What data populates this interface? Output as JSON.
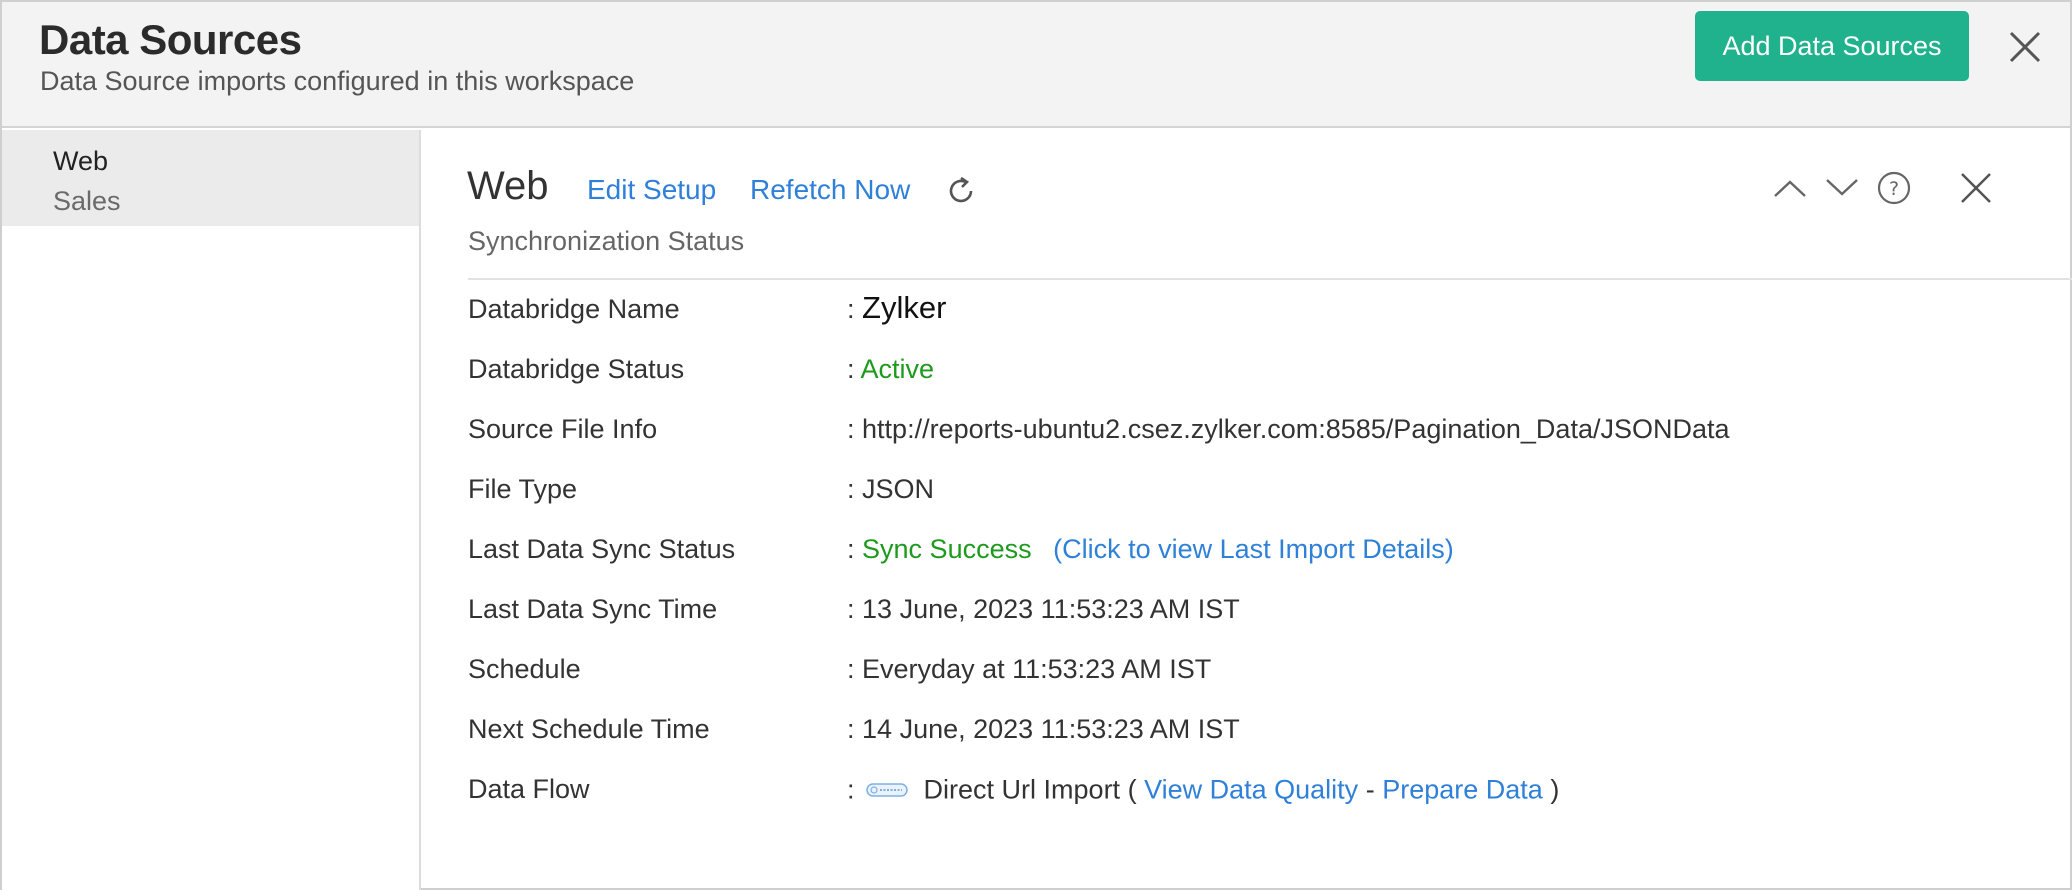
{
  "header": {
    "title": "Data Sources",
    "subtitle": "Data Source imports configured in this workspace",
    "add_button_label": "Add Data Sources"
  },
  "sidebar": {
    "items": [
      {
        "title": "Web",
        "subtitle": "Sales"
      }
    ]
  },
  "content": {
    "title": "Web",
    "edit_setup_label": "Edit Setup",
    "refetch_now_label": "Refetch Now",
    "section_label": "Synchronization Status",
    "rows": {
      "databridge_name": {
        "label": "Databridge Name",
        "value": "Zylker"
      },
      "databridge_status": {
        "label": "Databridge Status",
        "value": "Active"
      },
      "source_file_info": {
        "label": "Source File Info",
        "value": "http://reports-ubuntu2.csez.zylker.com:8585/Pagination_Data/JSONData"
      },
      "file_type": {
        "label": "File Type",
        "value": "JSON"
      },
      "last_sync_status": {
        "label": "Last Data Sync Status",
        "value": "Sync Success",
        "link": "(Click to view Last Import Details)"
      },
      "last_sync_time": {
        "label": "Last Data Sync Time",
        "value": "13 June, 2023 11:53:23 AM IST"
      },
      "schedule": {
        "label": "Schedule",
        "value": "Everyday at 11:53:23 AM IST"
      },
      "next_schedule_time": {
        "label": "Next Schedule Time",
        "value": "14 June, 2023 11:53:23 AM IST"
      },
      "data_flow": {
        "label": "Data Flow",
        "import_type": "Direct Url Import (",
        "view_quality_link": "View Data Quality",
        "separator": "-",
        "prepare_data_link": "Prepare Data",
        "close_paren": ")"
      }
    },
    "value_prefix": ":"
  },
  "colors": {
    "accent_button": "#1fb28c",
    "link": "#2f80d9",
    "success": "#1e9a1e",
    "header_bg": "#f3f3f3",
    "sidebar_selected_bg": "#ebebeb"
  },
  "icons": {
    "close": "close-icon",
    "refresh": "refresh-icon",
    "up": "chevron-up-icon",
    "down": "chevron-down-icon",
    "help": "help-icon",
    "url": "url-icon"
  }
}
